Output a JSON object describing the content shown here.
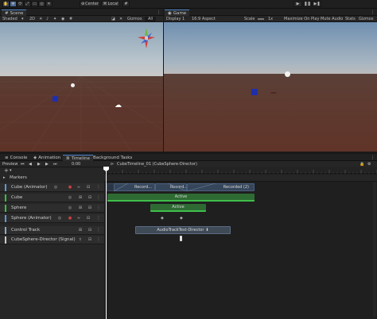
{
  "toolbar": {
    "center_label": "Center",
    "local_label": "Local",
    "tools": [
      "hand-tool",
      "move-tool",
      "rotate-tool",
      "scale-tool",
      "rect-tool",
      "transform-tool",
      "custom-tool"
    ]
  },
  "scene": {
    "tab_label": "Scene",
    "shading": "Shaded",
    "mode_2d": "2D",
    "gizmos_label": "Gizmos",
    "search_placeholder": "All"
  },
  "game": {
    "tab_label": "Game",
    "display": "Display 1",
    "aspect": "16:9 Aspect",
    "scale_label": "Scale",
    "scale_value": "1x",
    "maximize": "Maximize On Play",
    "mute": "Mute Audio",
    "stats": "Stats",
    "gizmos": "Gizmos"
  },
  "lower_tabs": {
    "console": "Console",
    "animation": "Animation",
    "timeline": "Timeline",
    "background_tasks": "Background Tasks"
  },
  "timeline": {
    "preview_label": "Preview",
    "time_value": "0:00",
    "asset_name": "CubeTimeline_01 (CubeSphere-Director)",
    "markers_label": "Markers",
    "ruler_ticks": [
      "0",
      "20",
      "40",
      "60",
      "80",
      "100",
      "120",
      "140",
      "160",
      "180",
      "200",
      "220",
      "240",
      "260",
      "280",
      "300",
      "320",
      "340"
    ],
    "tracks": [
      {
        "label": "Cube (Animator)",
        "color": "#5c9ad6"
      },
      {
        "label": "Cube",
        "color": "#33c43a"
      },
      {
        "label": "Sphere",
        "color": "#33c43a"
      },
      {
        "label": "Sphere (Animator)",
        "color": "#5c9ad6"
      },
      {
        "label": "Control Track",
        "color": "#8fa7bd"
      },
      {
        "label": "CubeSphere-Director (Signal)",
        "color": "#cccccc"
      }
    ],
    "clips": {
      "recorded_1": "Record...",
      "recorded_2": "Record...",
      "recorded_3": "Recorded (2)",
      "active_cube": "Active",
      "active_sphere": "Active",
      "audio_track": "AudioTrackTest-Director"
    }
  },
  "colors": {
    "accent": "#4a80c8",
    "activation_clip": "#2e6b33",
    "animation_clip": "#3a4d66",
    "control_clip": "#3f4a57"
  }
}
